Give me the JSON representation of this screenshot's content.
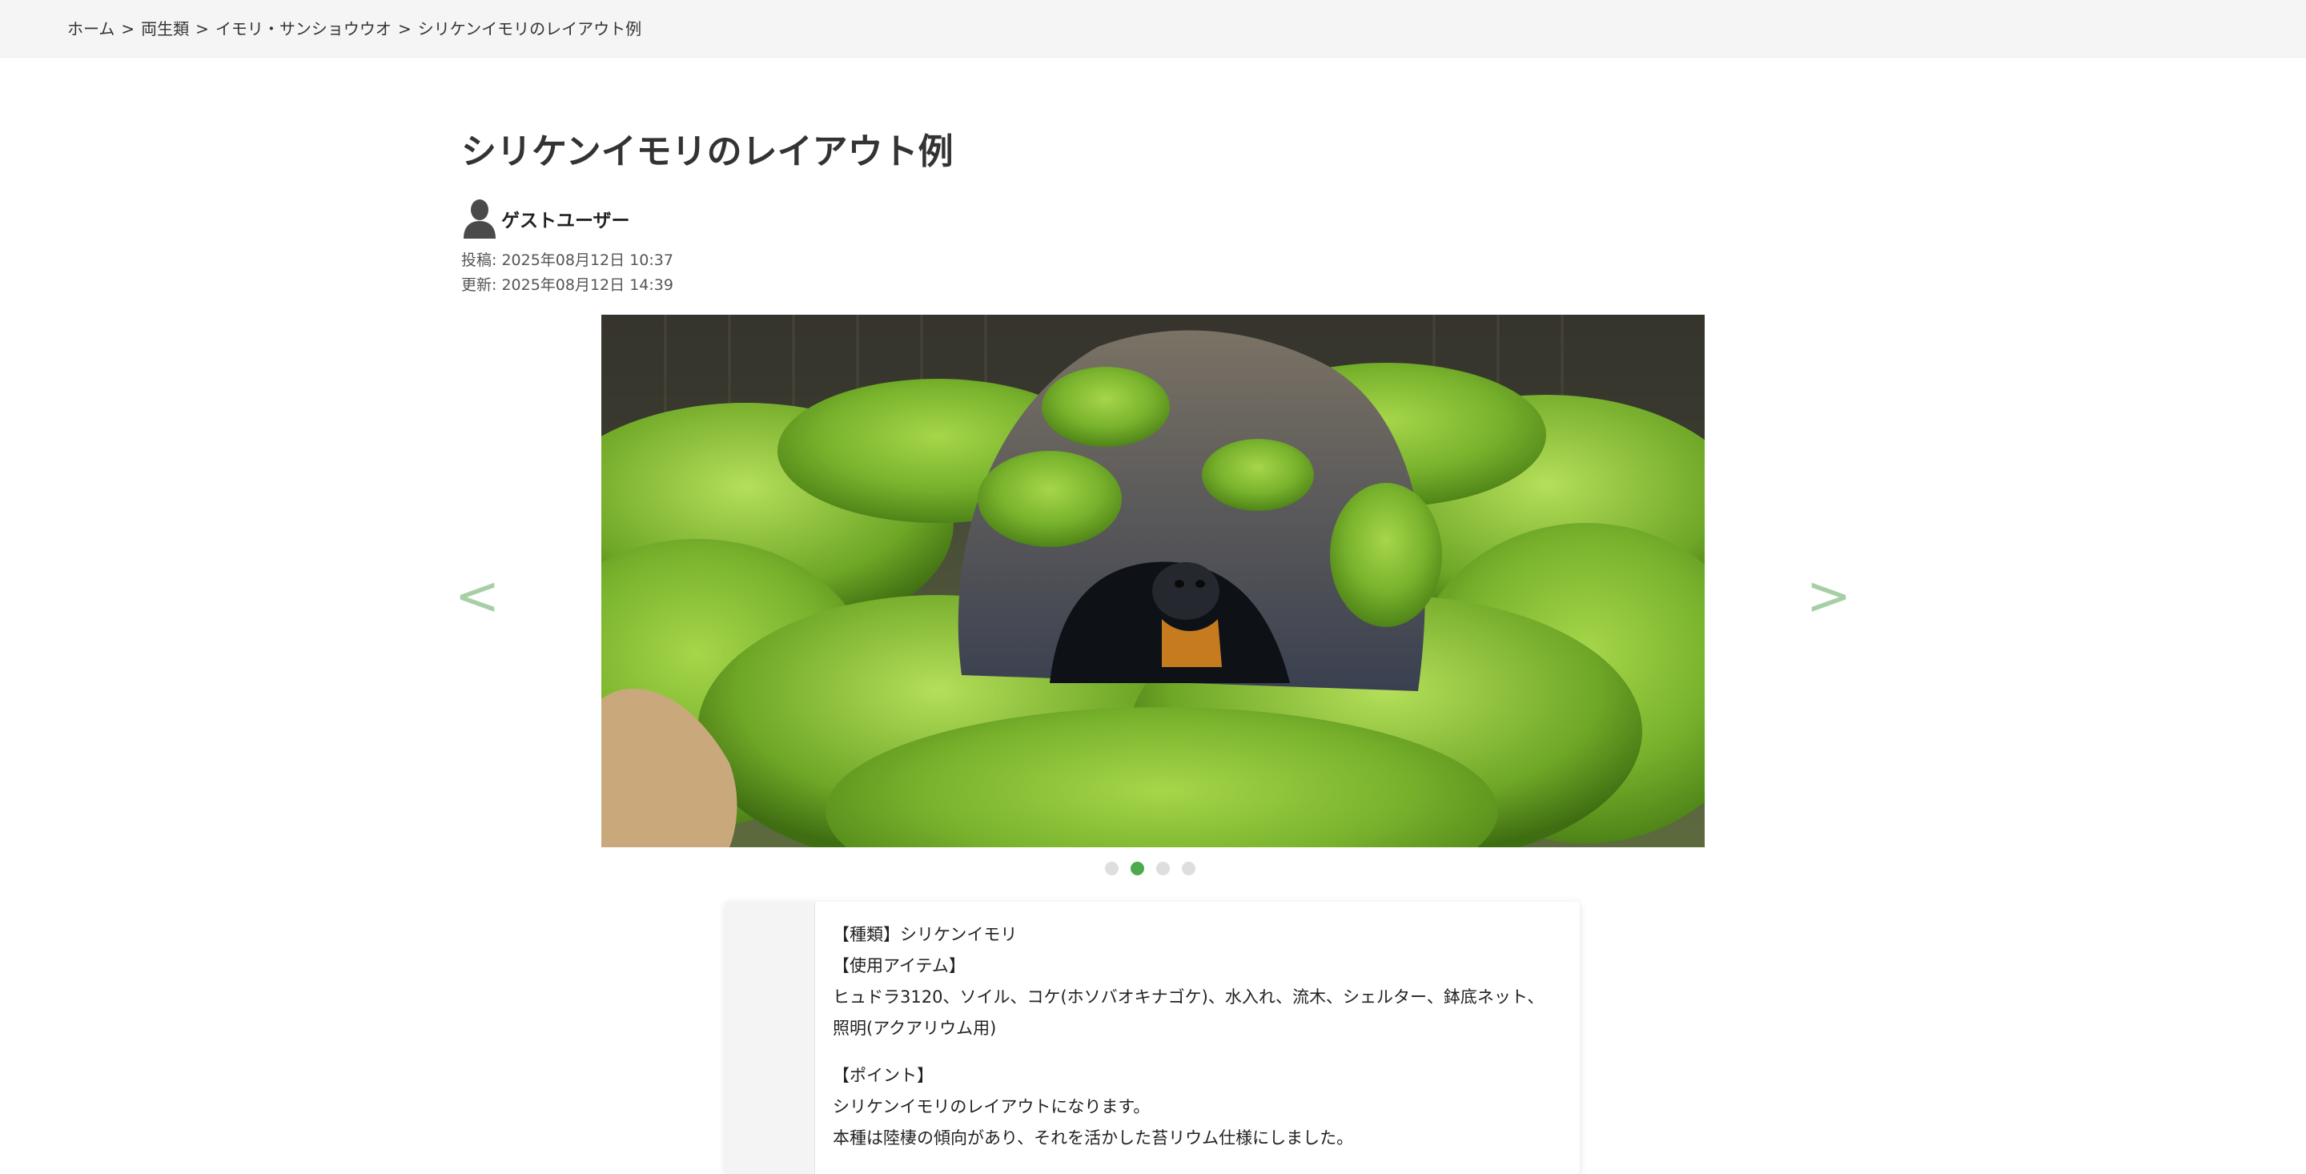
{
  "breadcrumb": {
    "items": [
      "ホーム",
      "両生類",
      "イモリ・サンショウウオ",
      "シリケンイモリのレイアウト例"
    ],
    "separator": ">"
  },
  "title": "シリケンイモリのレイアウト例",
  "author": {
    "name": "ゲストユーザー",
    "icon": "user-avatar-icon"
  },
  "meta": {
    "posted": "投稿: 2025年08月12日 10:37",
    "updated": "更新: 2025年08月12日 14:39"
  },
  "carousel": {
    "prev": "<",
    "next": ">",
    "active_index": 1,
    "total": 4,
    "image_subject": "newt-in-moss-terrarium-photo"
  },
  "description": {
    "line1": "【種類】シリケンイモリ",
    "line2": "【使用アイテム】",
    "line3": "ヒュドラ3120、ソイル、コケ(ホソバオキナゴケ)、水入れ、流木、シェルター、鉢底ネット、",
    "line4": "照明(アクアリウム用)",
    "line5": "【ポイント】",
    "line6": "シリケンイモリのレイアウトになります。",
    "line7": "本種は陸棲の傾向があり、それを活かした苔リウム仕様にしました。"
  },
  "colors": {
    "accent": "#4caa4c",
    "arrow": "#a6cfa6",
    "breadcrumb_bg": "#f5f5f5"
  }
}
